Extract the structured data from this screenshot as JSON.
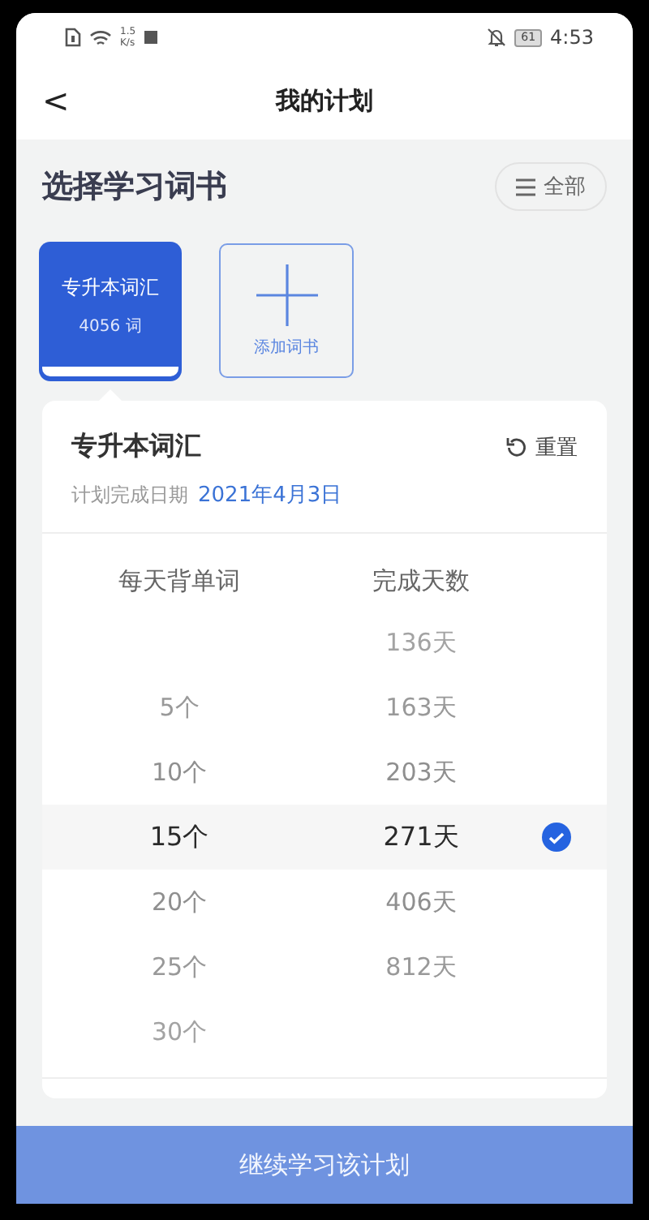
{
  "status_bar": {
    "speed_value": "1.5",
    "speed_unit": "K/s",
    "battery": "61",
    "time": "4:53"
  },
  "header": {
    "back": "<",
    "title": "我的计划"
  },
  "section": {
    "title": "选择学习词书",
    "filter_button": "全部"
  },
  "books": [
    {
      "kind": "book",
      "title": "专升本词汇",
      "count": "4056 词",
      "selected": true
    },
    {
      "kind": "add",
      "label": "添加词书",
      "selected": false
    }
  ],
  "plan": {
    "title": "专升本词汇",
    "reset": "重置",
    "date_label": "计划完成日期",
    "date": "2021年4月3日",
    "columns": [
      "每天背单词",
      "完成天数"
    ],
    "rows": [
      {
        "days": "136天",
        "selected": false
      },
      {
        "words": "5个",
        "days": "163天",
        "selected": false
      },
      {
        "words": "10个",
        "days": "203天",
        "selected": false
      },
      {
        "words": "15个",
        "days": "271天",
        "selected": true
      },
      {
        "words": "20个",
        "days": "406天",
        "selected": false
      },
      {
        "words": "25个",
        "days": "812天",
        "selected": false
      },
      {
        "words": "30个",
        "selected": false
      }
    ]
  },
  "continue_button": {
    "label": "继续学习该计划",
    "disabled": true
  }
}
